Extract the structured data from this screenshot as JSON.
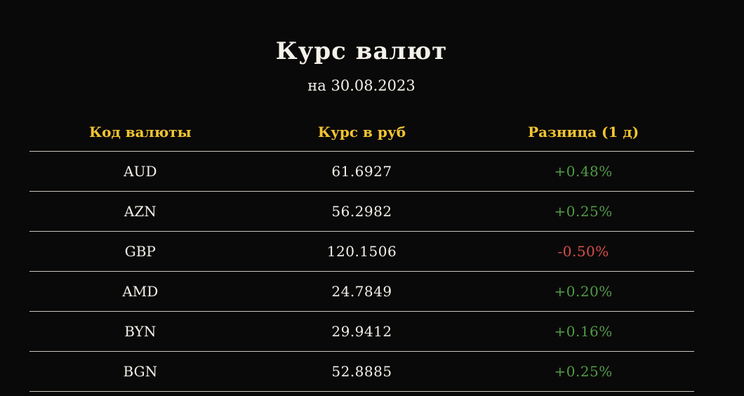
{
  "page": {
    "title": "Курс валют",
    "subtitle": "на 30.08.2023"
  },
  "table": {
    "headers": [
      "Код валюты",
      "Курс в руб",
      "Разница (1 д)"
    ],
    "rows": [
      {
        "code": "AUD",
        "rate": "61.6927",
        "diff": "+0.48%",
        "trend": "positive"
      },
      {
        "code": "AZN",
        "rate": "56.2982",
        "diff": "+0.25%",
        "trend": "positive"
      },
      {
        "code": "GBP",
        "rate": "120.1506",
        "diff": "-0.50%",
        "trend": "negative"
      },
      {
        "code": "AMD",
        "rate": "24.7849",
        "diff": "+0.20%",
        "trend": "positive"
      },
      {
        "code": "BYN",
        "rate": "29.9412",
        "diff": "+0.16%",
        "trend": "positive"
      },
      {
        "code": "BGN",
        "rate": "52.8885",
        "diff": "+0.25%",
        "trend": "positive"
      }
    ]
  },
  "colors": {
    "background": "#0a0909",
    "header_accent": "#f2c531",
    "positive": "#4f9a47",
    "negative": "#d44f4a",
    "row_divider": "#c9c6c0"
  }
}
